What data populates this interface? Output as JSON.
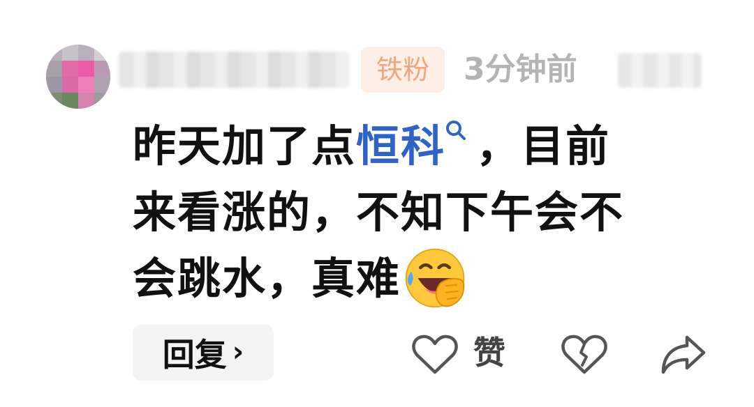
{
  "comment": {
    "badge": "铁粉",
    "timestamp": "3分钟前",
    "text": {
      "line1_before": "昨天加了点",
      "stock_name": "恒科",
      "line1_after": "，目前",
      "line2": "来看涨的，不知下午会不",
      "line3": "会跳水，真难"
    },
    "emoji": "laughing-crying-emoji",
    "actions": {
      "reply_label": "回复",
      "reply_chevron": "›",
      "like_label": "赞",
      "like_icon": "heart-outline-icon",
      "dislike_icon": "broken-heart-icon",
      "share_icon": "share-arrow-icon"
    },
    "colors": {
      "link": "#2f64c4",
      "badge_bg": "#fdeee6",
      "badge_text": "#f0a77f",
      "timestamp": "#b4b4b4"
    }
  }
}
